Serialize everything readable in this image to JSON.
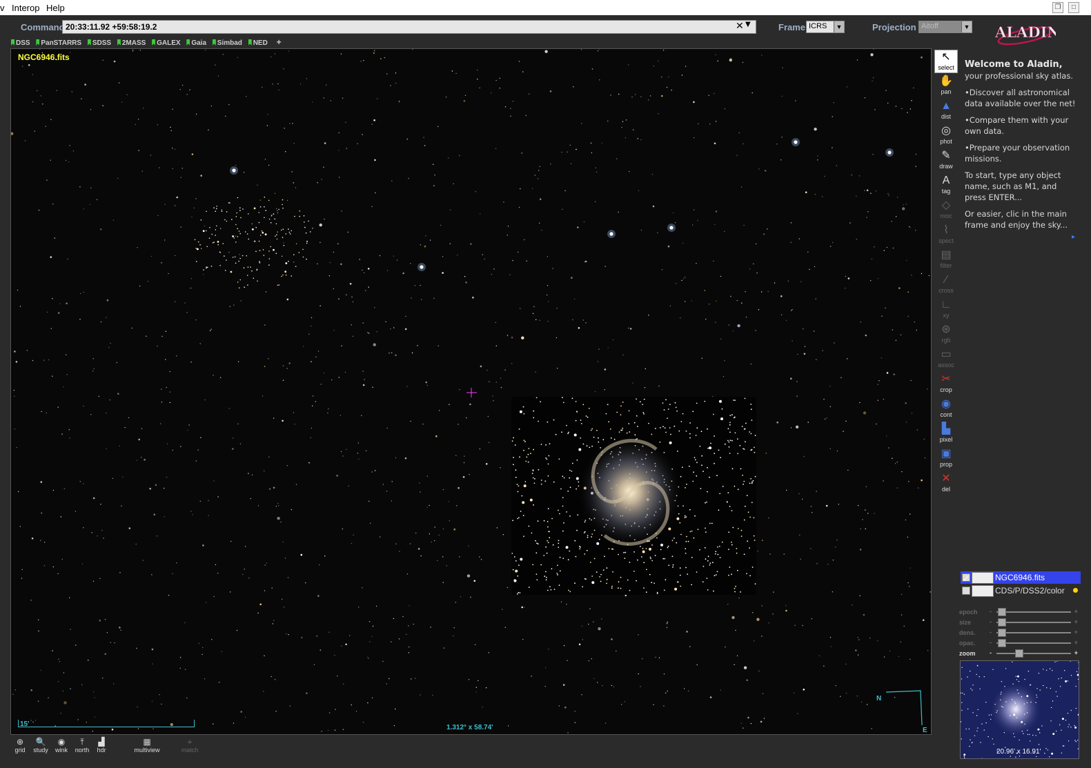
{
  "menu": {
    "items": [
      "v",
      "Interop",
      "Help"
    ]
  },
  "command": {
    "label": "Command",
    "value": "20:33:11.92 +59:58:19.2",
    "clear": "✕",
    "drop": "▼"
  },
  "frame": {
    "label": "Frame",
    "value": "ICRS"
  },
  "projection": {
    "label": "Projection",
    "value": "Aitoff"
  },
  "logo": {
    "text": "ALADIN"
  },
  "surveys": [
    "DSS",
    "PanSTARRS",
    "SDSS",
    "2MASS",
    "GALEX",
    "Gaia",
    "Simbad",
    "NED"
  ],
  "add_survey": "+",
  "viewer": {
    "image_name": "NGC6946.fits",
    "scale_label": "15'",
    "fov_label": "1.312° x 58.74'",
    "north": "N",
    "east": "E"
  },
  "tools": [
    {
      "id": "select",
      "label": "select",
      "icon": "arrow-icon",
      "enabled": true,
      "selected": true
    },
    {
      "id": "pan",
      "label": "pan",
      "icon": "hand-icon",
      "enabled": true
    },
    {
      "id": "dist",
      "label": "dist",
      "icon": "distance-icon",
      "enabled": true
    },
    {
      "id": "phot",
      "label": "phot",
      "icon": "photometry-icon",
      "enabled": true
    },
    {
      "id": "draw",
      "label": "draw",
      "icon": "pencil-icon",
      "enabled": true
    },
    {
      "id": "tag",
      "label": "tag",
      "icon": "tag-icon",
      "enabled": true
    },
    {
      "id": "moc",
      "label": "moc",
      "icon": "moc-icon",
      "enabled": false
    },
    {
      "id": "spect",
      "label": "spect",
      "icon": "spectrum-icon",
      "enabled": false
    },
    {
      "id": "filter",
      "label": "filter",
      "icon": "filter-icon",
      "enabled": false
    },
    {
      "id": "cross",
      "label": "cross",
      "icon": "cross-icon",
      "enabled": false
    },
    {
      "id": "xy",
      "label": "xy",
      "icon": "xy-plot-icon",
      "enabled": false
    },
    {
      "id": "rgb",
      "label": "rgb",
      "icon": "rgb-icon",
      "enabled": false
    },
    {
      "id": "assoc",
      "label": "assoc",
      "icon": "assoc-icon",
      "enabled": false
    },
    {
      "id": "crop",
      "label": "crop",
      "icon": "scissors-icon",
      "enabled": true
    },
    {
      "id": "cont",
      "label": "cont",
      "icon": "contour-icon",
      "enabled": true
    },
    {
      "id": "pixel",
      "label": "pixel",
      "icon": "histogram-icon",
      "enabled": true
    },
    {
      "id": "prop",
      "label": "prop",
      "icon": "properties-icon",
      "enabled": true
    },
    {
      "id": "del",
      "label": "del",
      "icon": "delete-icon",
      "enabled": true
    }
  ],
  "welcome": {
    "title": "Welcome to Aladin,",
    "subtitle": "your professional sky atlas.",
    "p1": "•Discover all astronomical data available over the net!",
    "p2": "•Compare them with your own data.",
    "p3": "•Prepare your observation missions.",
    "p4": "To start, type any object name, such as M1, and press ENTER...",
    "p5": "Or easier, clic in the main frame and enjoy the sky...",
    "more": "▸"
  },
  "layers": [
    {
      "name": "NGC6946.fits",
      "checked": true,
      "active": true
    },
    {
      "name": "CDS/P/DSS2/color",
      "checked": false,
      "active": false
    }
  ],
  "sliders": [
    {
      "label": "epoch",
      "value": 0.02
    },
    {
      "label": "size",
      "value": 0.02
    },
    {
      "label": "dens.",
      "value": 0.02
    },
    {
      "label": "opac.",
      "value": 0.02
    },
    {
      "label": "zoom",
      "value": 0.28
    }
  ],
  "slider_minus": "-",
  "slider_plus": "+",
  "overview": {
    "label": "20.96' x 16.91'"
  },
  "bottom_buttons": [
    {
      "label": "grid",
      "icon": "grid-icon",
      "enabled": true
    },
    {
      "label": "study",
      "icon": "study-icon",
      "enabled": true
    },
    {
      "label": "wink",
      "icon": "eye-icon",
      "enabled": true
    },
    {
      "label": "north",
      "icon": "north-icon",
      "enabled": true
    },
    {
      "label": "hdr",
      "icon": "hdr-icon",
      "enabled": true
    },
    {
      "label": "multiview",
      "icon": "multiview-icon",
      "enabled": true
    },
    {
      "label": "match",
      "icon": "match-icon",
      "enabled": false
    }
  ],
  "colors": {
    "accent": "#3543ea",
    "image_label": "#ffff3c",
    "overlay": "#3cc0d0",
    "label": "#9fb0c8"
  }
}
